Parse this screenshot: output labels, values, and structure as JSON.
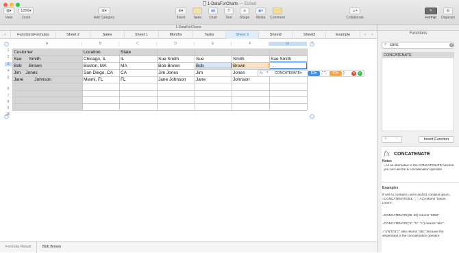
{
  "window": {
    "title": "1-DataForCharts",
    "edited": "— Edited"
  },
  "toolbar": {
    "view": "View",
    "zoom_value": "125%",
    "zoom": "Zoom",
    "add_category": "Add Category",
    "insert": "Insert",
    "table": "Table",
    "chart": "Chart",
    "text": "Text",
    "shape": "Shape",
    "media": "Media",
    "comment": "Comment",
    "collaborate": "Collaborate",
    "format": "Format",
    "organize": "Organize"
  },
  "tab_title": "1-DataForCharts",
  "sheets": [
    "FunctionsFormulas",
    "Sheet 2",
    "Sales",
    "Sheet 1",
    "Months",
    "Tasks",
    "Sheet 3",
    "Sheet2",
    "Sheet3",
    "Example"
  ],
  "active_sheet": "Sheet 3",
  "grid": {
    "columns": [
      "A",
      "B",
      "C",
      "D",
      "E",
      "F",
      "G"
    ],
    "rows": [
      "1",
      "2",
      "3",
      "4",
      "5",
      "6",
      "7",
      "8",
      "9",
      "10"
    ],
    "header_row": [
      "Customer",
      "Location",
      "State",
      "",
      "",
      "",
      ""
    ],
    "data": [
      [
        "Sue      Smith",
        "Chicago, IL",
        "IL",
        "Sue Smith",
        "Sue",
        "Smith",
        "Sue Smith"
      ],
      [
        "Bob      Brown",
        "Boston, MA",
        "MA",
        "Bob Brown",
        "Bob",
        "Brown",
        "..."
      ],
      [
        "Jim    Jones",
        "San Diego, CA",
        "CA",
        "Jim Jones",
        "Jim",
        "Jones",
        ""
      ],
      [
        "Jane         Johnson",
        "Miami, FL",
        "FL",
        "Jane Johnson",
        "Jane",
        "Johnson",
        ""
      ]
    ]
  },
  "formula": {
    "fx": "fx",
    "function": "CONCATENATE",
    "token1": "E3",
    "separator": ",\" \",",
    "token2": "F3",
    "suffix": ")"
  },
  "sidebar": {
    "title": "Functions",
    "search_value": "conc",
    "result": "CONCATENATE",
    "insert_button": "Insert Function",
    "fx": "fx",
    "func_name": "CONCATENATE",
    "notes_heading": "Notes",
    "note": "As an alternative to the CONCATENATE function, you can use the & concatenation operator.",
    "examples_heading": "Examples",
    "ex1": "If cell A1 contains Lorem and B1 contains ipsum, =CONCATENATE(B1, \", \", A1) returns \"ipsum, Lorem\".",
    "ex2": "=CONCATENATE(60, 60) returns \"6060\".",
    "ex3": "=CONCATENATE(\"a\", \"b\", \"c\") returns \"abc\".",
    "ex4": "=\"a\"&\"b\"&\"c\" also returns \"abc\" because the ampersand is the concatenation operator."
  },
  "status": {
    "label": "Formula Result",
    "value": "Bob Brown"
  },
  "colors": {
    "accent": "#2d78d0",
    "token_blue": "#4a90e2",
    "token_orange": "#f2a54a",
    "cancel": "#e5453b",
    "accept": "#3dbb50"
  }
}
